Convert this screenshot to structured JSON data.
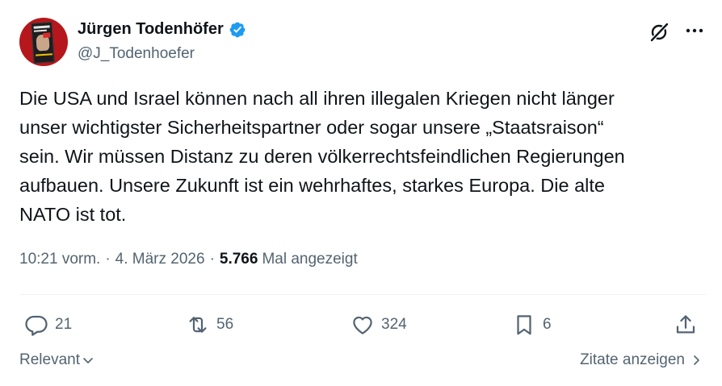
{
  "author": {
    "name": "Jürgen Todenhöfer",
    "handle": "@J_Todenhoefer",
    "verified": true,
    "verified_color": "#1d9bf0",
    "avatar_background": "#b5171c"
  },
  "header_icons": {
    "grok": "grok-icon",
    "more": "more-icon"
  },
  "tweet": {
    "text": "Die USA und Israel können nach all ihren illegalen Kriegen nicht länger\nunser wichtigster Sicherheitspartner oder sogar unsere „Staatsraison“\nsein. Wir müssen Distanz zu deren völkerrechtsfeindlichen Regierungen\naufbauen. Unsere Zukunft ist ein wehrhaftes, starkes Europa. Die alte\nNATO ist tot."
  },
  "meta": {
    "time": "10:21 vorm.",
    "separator": "·",
    "date": "4. März 2026",
    "views_count": "5.766",
    "views_label": "Mal angezeigt"
  },
  "actions": {
    "replies": {
      "icon": "reply-icon",
      "count": "21"
    },
    "reposts": {
      "icon": "repost-icon",
      "count": "56"
    },
    "likes": {
      "icon": "like-icon",
      "count": "324"
    },
    "bookmarks": {
      "icon": "bookmark-icon",
      "count": "6"
    },
    "share": {
      "icon": "share-icon"
    }
  },
  "footer": {
    "sort_label": "Relevant",
    "quotes_label": "Zitate anzeigen"
  }
}
